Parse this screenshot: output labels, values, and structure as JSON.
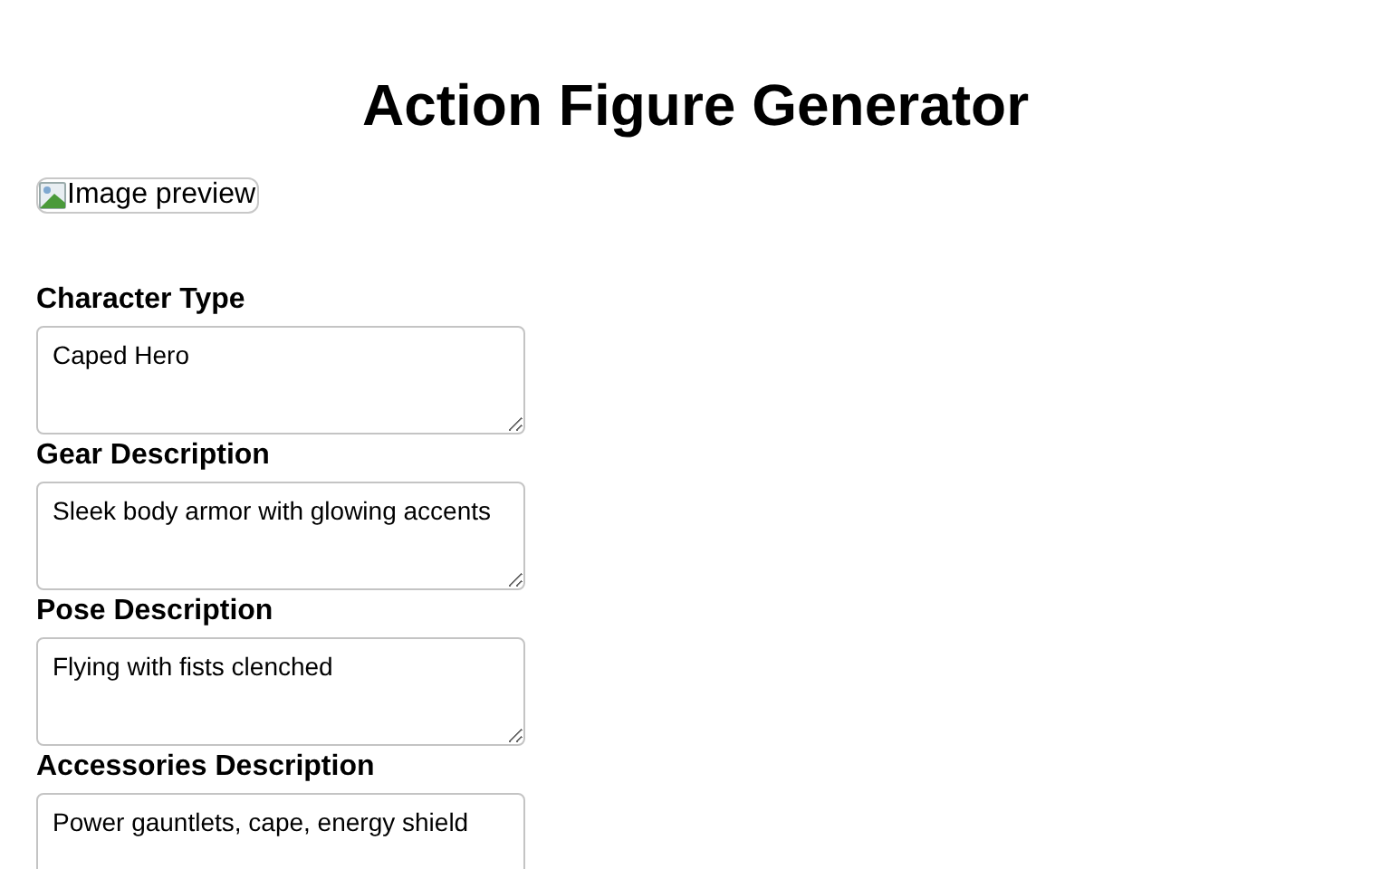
{
  "title": "Action Figure Generator",
  "image_preview": {
    "alt": "Image preview"
  },
  "fields": [
    {
      "label": "Character Type",
      "value": "Caped Hero"
    },
    {
      "label": "Gear Description",
      "value": "Sleek body armor with glowing accents"
    },
    {
      "label": "Pose Description",
      "value": "Flying with fists clenched"
    },
    {
      "label": "Accessories Description",
      "value": "Power gauntlets, cape, energy shield"
    }
  ]
}
